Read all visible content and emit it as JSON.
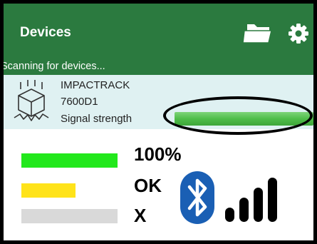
{
  "appbar": {
    "title": "Devices",
    "actions": [
      {
        "icon": "folder-icon"
      },
      {
        "icon": "gear-icon"
      }
    ],
    "color": "#2b7a3f"
  },
  "scan": {
    "status": "Scanning for devices..."
  },
  "device": {
    "name": "IMPACTRACK",
    "id": "7600D1",
    "signal_label": "Signal strength",
    "signal_percent": 100,
    "signal_color": "#4fbd4a",
    "row_color": "#dff1f2",
    "icon": "cube-impact-icon"
  },
  "legend": {
    "items": [
      {
        "label": "100%",
        "color": "#22e81c",
        "level_percent": 100
      },
      {
        "label": "OK",
        "color": "#ffe31a",
        "level_percent": 56
      },
      {
        "label": "X",
        "color": "#d9d9d9",
        "level_percent": 100
      }
    ],
    "bluetooth_icon": "bluetooth-icon",
    "bluetooth_color": "#1a5fb4",
    "signal_icon": "signal-bars-icon"
  }
}
